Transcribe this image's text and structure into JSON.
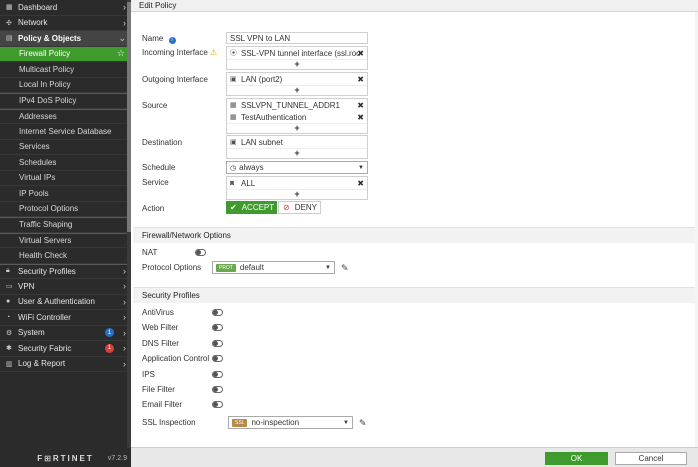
{
  "sidebar": {
    "items": [
      {
        "label": "Dashboard",
        "icon": "dashboard-icon",
        "glyph": "▦",
        "kind": "top",
        "chevron": "›"
      },
      {
        "label": "Network",
        "icon": "network-icon",
        "glyph": "✣",
        "kind": "top",
        "chevron": "›"
      },
      {
        "label": "Policy & Objects",
        "icon": "policy-icon",
        "glyph": "▤",
        "kind": "group",
        "chevron": "⌄"
      },
      {
        "label": "Firewall Policy",
        "kind": "active"
      },
      {
        "label": "Multicast Policy",
        "kind": "sub"
      },
      {
        "label": "Local In Policy",
        "kind": "sub"
      },
      {
        "label": "IPv4 DoS Policy",
        "kind": "sub",
        "sep": true
      },
      {
        "label": "Addresses",
        "kind": "sub",
        "sep": true
      },
      {
        "label": "Internet Service Database",
        "kind": "sub"
      },
      {
        "label": "Services",
        "kind": "sub"
      },
      {
        "label": "Schedules",
        "kind": "sub"
      },
      {
        "label": "Virtual IPs",
        "kind": "sub"
      },
      {
        "label": "IP Pools",
        "kind": "sub"
      },
      {
        "label": "Protocol Options",
        "kind": "sub"
      },
      {
        "label": "Traffic Shaping",
        "kind": "sub",
        "sep": true
      },
      {
        "label": "Virtual Servers",
        "kind": "sub",
        "sep": true
      },
      {
        "label": "Health Check",
        "kind": "sub"
      },
      {
        "label": "Security Profiles",
        "icon": "lock-icon",
        "glyph": "🔒︎",
        "kind": "top",
        "chevron": "›",
        "sep": true
      },
      {
        "label": "VPN",
        "icon": "monitor-icon",
        "glyph": "▭",
        "kind": "top",
        "chevron": "›"
      },
      {
        "label": "User & Authentication",
        "icon": "user-icon",
        "glyph": "●",
        "kind": "top",
        "chevron": "›"
      },
      {
        "label": "WiFi Controller",
        "icon": "wifi-icon",
        "glyph": "◔",
        "kind": "top",
        "chevron": "›"
      },
      {
        "label": "System",
        "icon": "gear-icon",
        "glyph": "⚙",
        "kind": "top",
        "chevron": "›",
        "badge": "1",
        "badge_color": "#2a6fc9"
      },
      {
        "label": "Security Fabric",
        "icon": "fabric-icon",
        "glyph": "✱",
        "kind": "top",
        "chevron": "›",
        "badge": "1",
        "badge_color": "#d9403a"
      },
      {
        "label": "Log & Report",
        "icon": "report-icon",
        "glyph": "▥",
        "kind": "top",
        "chevron": "›"
      }
    ],
    "brand": "F⊞RTINET",
    "version": "v7.2.9"
  },
  "header": {
    "title": "Edit Policy"
  },
  "form": {
    "name_label": "Name",
    "name_value": "SSL VPN to LAN",
    "incoming_label": "Incoming Interface",
    "incoming_value": "SSL-VPN tunnel interface (ssl.roo",
    "outgoing_label": "Outgoing Interface",
    "outgoing_value": "LAN (port2)",
    "source_label": "Source",
    "source_values": [
      "SSLVPN_TUNNEL_ADDR1",
      "TestAuthentication"
    ],
    "destination_label": "Destination",
    "destination_value": "LAN subnet",
    "schedule_label": "Schedule",
    "schedule_value": "always",
    "service_label": "Service",
    "service_value": "ALL",
    "action_label": "Action",
    "accept_label": "ACCEPT",
    "deny_label": "DENY",
    "add": "+",
    "remove": "✖"
  },
  "firewall_section": {
    "title": "Firewall/Network Options",
    "nat_label": "NAT",
    "protocol_label": "Protocol Options",
    "protocol_badge": "PROT",
    "protocol_value": "default"
  },
  "security_section": {
    "title": "Security Profiles",
    "profiles": [
      "AntiVirus",
      "Web Filter",
      "DNS Filter",
      "Application Control",
      "IPS",
      "File Filter",
      "Email Filter"
    ],
    "ssl_label": "SSL Inspection",
    "ssl_badge": "SSL",
    "ssl_value": "no-inspection"
  },
  "footer": {
    "ok_label": "OK",
    "cancel_label": "Cancel"
  },
  "colors": {
    "accent": "#3f9b2e",
    "sidebar": "#2b2b2b",
    "deny": "#d9403a"
  }
}
